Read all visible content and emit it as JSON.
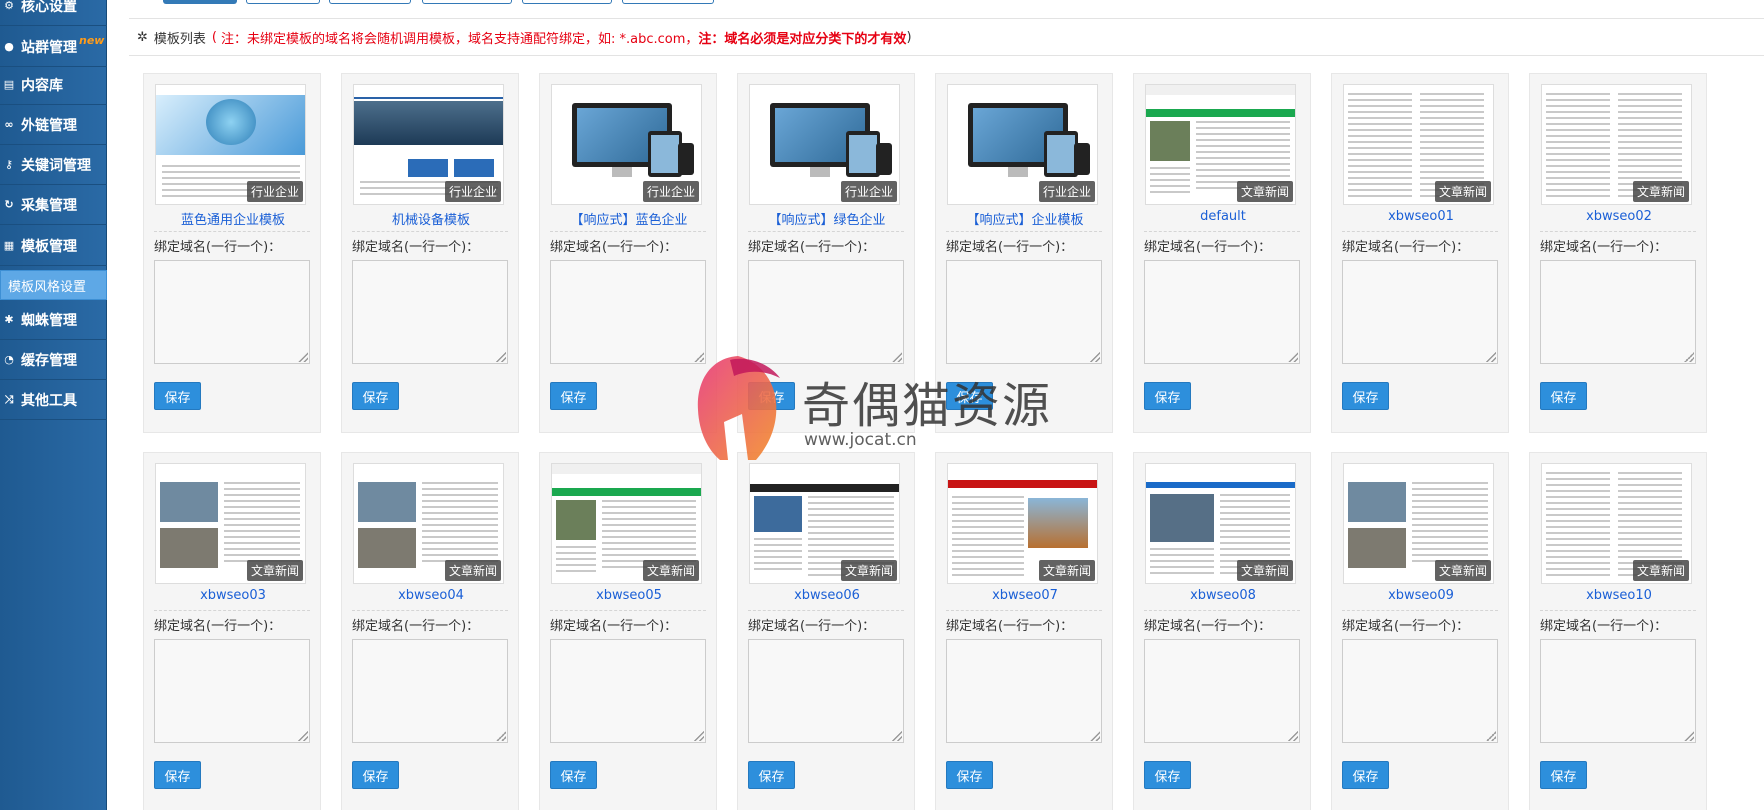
{
  "sidebar": {
    "items": [
      {
        "label": "核心设置",
        "icon": "gear-icon"
      },
      {
        "label": "站群管理",
        "icon": "users-icon",
        "badge": "new"
      },
      {
        "label": "内容库",
        "icon": "document-icon"
      },
      {
        "label": "外链管理",
        "icon": "link-icon"
      },
      {
        "label": "关键词管理",
        "icon": "key-icon"
      },
      {
        "label": "采集管理",
        "icon": "refresh-icon"
      },
      {
        "label": "模板管理",
        "icon": "windows-icon"
      },
      {
        "label": "蜘蛛管理",
        "icon": "android-icon"
      },
      {
        "label": "缓存管理",
        "icon": "dashboard-icon"
      },
      {
        "label": "其他工具",
        "icon": "shuffle-icon"
      }
    ],
    "active_sub": "模板风格设置"
  },
  "header": {
    "title": "模板列表",
    "open_paren": "(",
    "note_plain": "注：未绑定模板的域名将会随机调用模板，域名支持通配符绑定，如: *.abc.com，",
    "note_bold": "注：域名必须是对应分类下的才有效",
    "close_paren": ")"
  },
  "bind_label": "绑定域名(一行一个)：",
  "save_label": "保存",
  "accent_color": "#2d8fdc",
  "link_color": "#1a5fd6",
  "warn_color": "#e60012",
  "templates": [
    {
      "name": "蓝色通用企业模板",
      "tag": "行业企业",
      "style": "blue"
    },
    {
      "name": "机械设备模板",
      "tag": "行业企业",
      "style": "machine"
    },
    {
      "name": "【响应式】蓝色企业",
      "tag": "行业企业",
      "style": "resp"
    },
    {
      "name": "【响应式】绿色企业",
      "tag": "行业企业",
      "style": "resp"
    },
    {
      "name": "【响应式】企业模板",
      "tag": "行业企业",
      "style": "resp"
    },
    {
      "name": "default",
      "tag": "文章新闻",
      "style": "green"
    },
    {
      "name": "xbwseo01",
      "tag": "文章新闻",
      "style": "list"
    },
    {
      "name": "xbwseo02",
      "tag": "文章新闻",
      "style": "list"
    },
    {
      "name": "xbwseo03",
      "tag": "文章新闻",
      "style": "news"
    },
    {
      "name": "xbwseo04",
      "tag": "文章新闻",
      "style": "news"
    },
    {
      "name": "xbwseo05",
      "tag": "文章新闻",
      "style": "green"
    },
    {
      "name": "xbwseo06",
      "tag": "文章新闻",
      "style": "dark"
    },
    {
      "name": "xbwseo07",
      "tag": "文章新闻",
      "style": "red"
    },
    {
      "name": "xbwseo08",
      "tag": "文章新闻",
      "style": "bluebar"
    },
    {
      "name": "xbwseo09",
      "tag": "文章新闻",
      "style": "news"
    },
    {
      "name": "xbwseo10",
      "tag": "文章新闻",
      "style": "list"
    }
  ],
  "watermark": {
    "name": "奇偶猫资源",
    "url": "www.jocat.cn"
  }
}
